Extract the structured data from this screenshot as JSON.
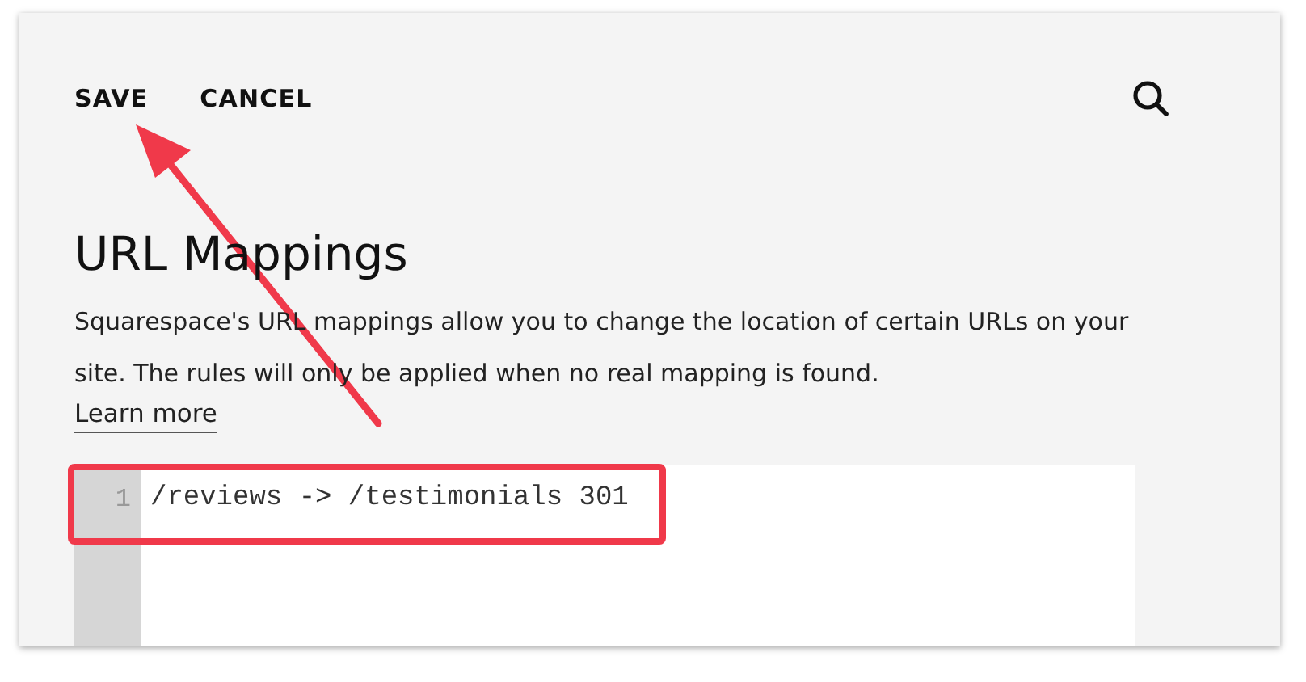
{
  "toolbar": {
    "buttons": [
      "SAVE",
      "CANCEL"
    ]
  },
  "title": "URL Mappings",
  "description": "Squarespace's URL mappings allow you to change the location of certain URLs on your site. The rules will only be applied when no real mapping is found.",
  "learn_more": "Learn more",
  "editor": {
    "lines": [
      {
        "number": "1",
        "text": "/reviews -> /testimonials 301"
      }
    ]
  }
}
